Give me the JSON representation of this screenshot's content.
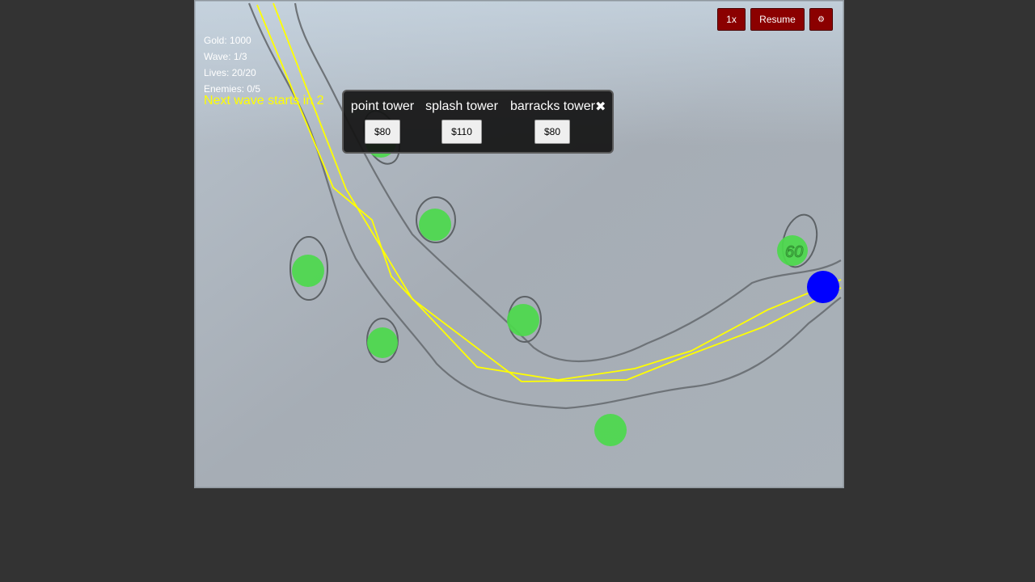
{
  "hud": {
    "gold": "Gold: 1000",
    "wave": "Wave: 1/3",
    "lives": "Lives: 20/20",
    "enemies": "Enemies: 0/5",
    "next_wave": "Next wave starts in 2"
  },
  "controls": {
    "speed_label": "1x",
    "resume_label": "Resume",
    "settings_icon": "⚙"
  },
  "tower_menu": {
    "towers": [
      {
        "name": "point tower",
        "price": "$80"
      },
      {
        "name": "splash tower",
        "price": "$110"
      },
      {
        "name": "barracks tower",
        "price": "$80"
      }
    ],
    "close_icon": "✖"
  },
  "map": {
    "doodle_text": "60"
  },
  "colors": {
    "background": "#333333",
    "button": "#8b0000",
    "tower_spot": "#4cd94c",
    "path_line": "#ffff00",
    "endpoint": "#0000ff",
    "hud_text": "#ffffff",
    "wave_text": "#ffff00"
  }
}
